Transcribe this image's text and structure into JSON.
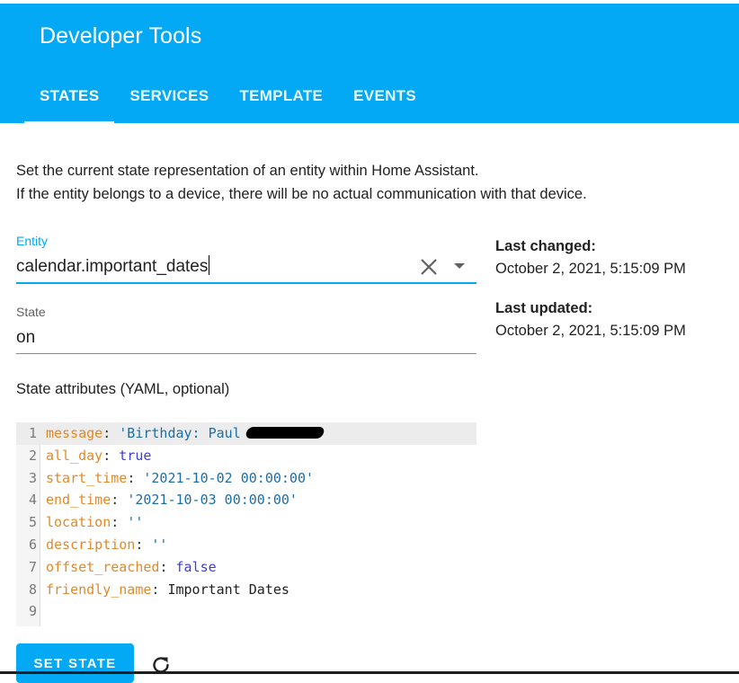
{
  "header": {
    "title": "Developer Tools",
    "tabs": [
      {
        "label": "STATES",
        "active": true
      },
      {
        "label": "SERVICES",
        "active": false
      },
      {
        "label": "TEMPLATE",
        "active": false
      },
      {
        "label": "EVENTS",
        "active": false
      }
    ]
  },
  "description": {
    "line1": "Set the current state representation of an entity within Home Assistant.",
    "line2": "If the entity belongs to a device, there will be no actual communication with that device."
  },
  "entity": {
    "label": "Entity",
    "value": "calendar.important_dates",
    "clear_icon": "close-icon",
    "dropdown_icon": "menu-down-icon"
  },
  "state": {
    "label": "State",
    "value": "on"
  },
  "info": {
    "last_changed_label": "Last changed:",
    "last_changed_value": "October 2, 2021, 5:15:09 PM",
    "last_updated_label": "Last updated:",
    "last_updated_value": "October 2, 2021, 5:15:09 PM"
  },
  "attributes": {
    "label": "State attributes (YAML, optional)",
    "lines": [
      {
        "num": "1",
        "key": "message",
        "value": "'Birthday: Paul",
        "type": "string",
        "redacted": true
      },
      {
        "num": "2",
        "key": "all_day",
        "value": "true",
        "type": "bool"
      },
      {
        "num": "3",
        "key": "start_time",
        "value": "'2021-10-02 00:00:00'",
        "type": "string"
      },
      {
        "num": "4",
        "key": "end_time",
        "value": "'2021-10-03 00:00:00'",
        "type": "string"
      },
      {
        "num": "5",
        "key": "location",
        "value": "''",
        "type": "string"
      },
      {
        "num": "6",
        "key": "description",
        "value": "''",
        "type": "string"
      },
      {
        "num": "7",
        "key": "offset_reached",
        "value": "false",
        "type": "bool"
      },
      {
        "num": "8",
        "key": "friendly_name",
        "value": "Important Dates",
        "type": "text"
      },
      {
        "num": "9",
        "key": "",
        "value": "",
        "type": "empty"
      }
    ]
  },
  "actions": {
    "set_state_label": "SET STATE",
    "refresh_icon": "refresh-icon"
  },
  "colors": {
    "primary": "#03a9f4",
    "yaml_key": "#e08a2b",
    "yaml_string": "#1d6ea1",
    "yaml_bool": "#3d3ce0"
  }
}
